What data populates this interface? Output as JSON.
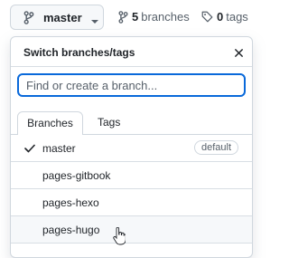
{
  "toolbar": {
    "branch_name": "master",
    "branches_count": "5",
    "branches_label": "branches",
    "tags_count": "0",
    "tags_label": "tags"
  },
  "dropdown": {
    "title": "Switch branches/tags",
    "filter_placeholder": "Find or create a branch...",
    "tabs": [
      {
        "label": "Branches",
        "active": true
      },
      {
        "label": "Tags",
        "active": false
      }
    ],
    "branches": [
      {
        "name": "master",
        "selected": true,
        "badge": "default"
      },
      {
        "name": "pages-gitbook"
      },
      {
        "name": "pages-hexo"
      },
      {
        "name": "pages-hugo",
        "hovered": true
      }
    ]
  },
  "icons": [
    "git-branch-icon",
    "caret-down-icon",
    "tag-icon",
    "close-icon",
    "check-icon",
    "hand-cursor-icon"
  ],
  "colors": {
    "accent": "#0969da",
    "border": "#d0d7de",
    "muted": "#57606a"
  }
}
